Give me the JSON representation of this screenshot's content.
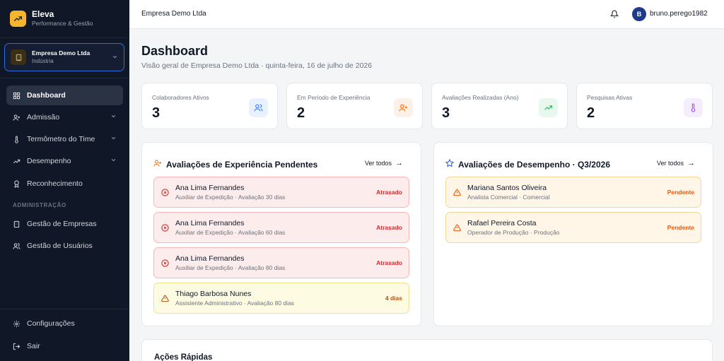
{
  "brand": {
    "name": "Eleva",
    "subtitle": "Performance & Gestão"
  },
  "company_selector": {
    "name": "Empresa Demo Ltda",
    "segment": "Indústria"
  },
  "nav": {
    "items": [
      {
        "label": "Dashboard",
        "icon": "grid-icon"
      },
      {
        "label": "Admissão",
        "icon": "user-plus-icon"
      },
      {
        "label": "Termômetro do Time",
        "icon": "thermometer-icon"
      },
      {
        "label": "Desempenho",
        "icon": "trending-up-icon"
      },
      {
        "label": "Reconhecimento",
        "icon": "award-icon"
      }
    ],
    "section_admin": "ADMINISTRAÇÃO",
    "admin_items": [
      {
        "label": "Gestão de Empresas",
        "icon": "building-icon"
      },
      {
        "label": "Gestão de Usuários",
        "icon": "users-icon"
      }
    ],
    "bottom_items": [
      {
        "label": "Configurações",
        "icon": "gear-icon"
      },
      {
        "label": "Sair",
        "icon": "logout-icon"
      }
    ]
  },
  "topbar": {
    "title": "Empresa Demo Ltda",
    "user_initial": "B",
    "user_name": "bruno.perego1982"
  },
  "page": {
    "title": "Dashboard",
    "subtitle": "Visão geral de Empresa Demo Ltda · quinta-feira, 16 de julho de 2026"
  },
  "stats": [
    {
      "label": "Colaboradores Ativos",
      "value": "3",
      "icon": "users-icon",
      "color": "#3b82f6"
    },
    {
      "label": "Em Período de Experiência",
      "value": "2",
      "icon": "user-plus-icon",
      "color": "#f97316"
    },
    {
      "label": "Avaliações Realizadas (Ano)",
      "value": "3",
      "icon": "trending-up-icon",
      "color": "#22c55e"
    },
    {
      "label": "Pesquisas Ativas",
      "value": "2",
      "icon": "thermometer-icon",
      "color": "#a855f7"
    }
  ],
  "experience_panel": {
    "title": "Avaliações de Experiência Pendentes",
    "see_all": "Ver todos",
    "rows": [
      {
        "name": "Ana Lima Fernandes",
        "detail": "Auxiliar de Expedição · Avaliação 30 dias",
        "status": "Atrasado"
      },
      {
        "name": "Ana Lima Fernandes",
        "detail": "Auxiliar de Expedição · Avaliação 60 dias",
        "status": "Atrasado"
      },
      {
        "name": "Ana Lima Fernandes",
        "detail": "Auxiliar de Expedição · Avaliação 80 dias",
        "status": "Atrasado"
      },
      {
        "name": "Thiago Barbosa Nunes",
        "detail": "Assistente Administrativo · Avaliação 80 dias",
        "status": "4 dias"
      }
    ]
  },
  "performance_panel": {
    "title": "Avaliações de Desempenho · Q3/2026",
    "see_all": "Ver todos",
    "rows": [
      {
        "name": "Mariana Santos Oliveira",
        "detail": "Analista Comercial · Comercial",
        "status": "Pendente"
      },
      {
        "name": "Rafael Pereira Costa",
        "detail": "Operador de Produção · Produção",
        "status": "Pendente"
      }
    ]
  },
  "quick_actions": {
    "title": "Ações Rápidas"
  },
  "colors": {
    "accent": "#2f6bd9",
    "danger": "#dc2626",
    "warning": "#b45309",
    "pending": "#ea580c",
    "sidebar": "#101827"
  }
}
